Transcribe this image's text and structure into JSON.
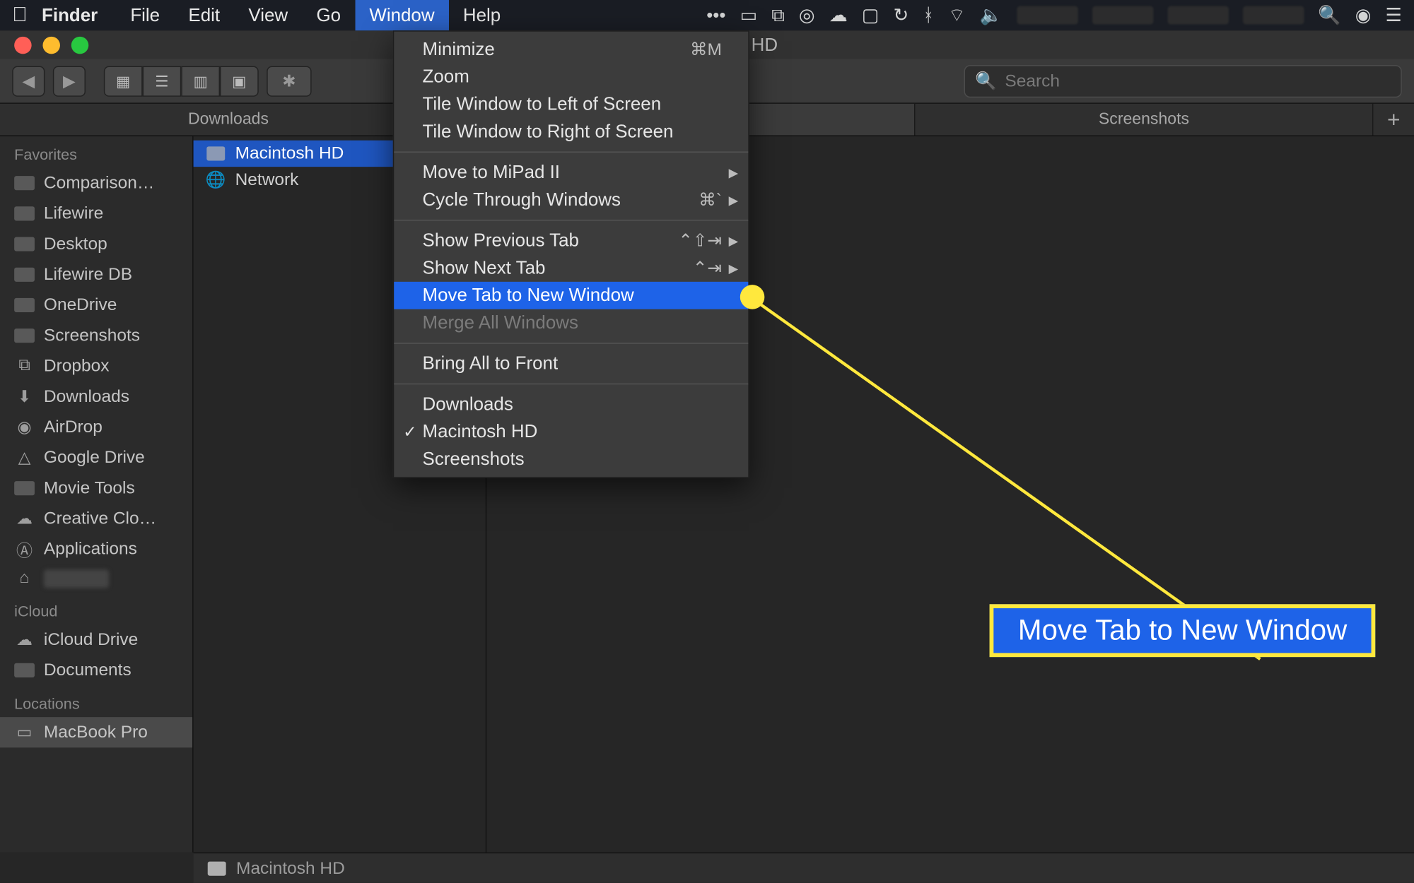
{
  "menubar": {
    "app": "Finder",
    "items": [
      "File",
      "Edit",
      "View",
      "Go",
      "Window",
      "Help"
    ],
    "active": "Window"
  },
  "window_title": "Macintosh HD",
  "search_placeholder": "Search",
  "tabs": [
    "Downloads",
    "Macintosh HD",
    "Screenshots"
  ],
  "active_tab": 1,
  "sidebar": {
    "sections": [
      {
        "title": "Favorites",
        "items": [
          {
            "label": "Comparison…",
            "icon": "folder"
          },
          {
            "label": "Lifewire",
            "icon": "folder"
          },
          {
            "label": "Desktop",
            "icon": "folder"
          },
          {
            "label": "Lifewire DB",
            "icon": "folder"
          },
          {
            "label": "OneDrive",
            "icon": "folder"
          },
          {
            "label": "Screenshots",
            "icon": "folder"
          },
          {
            "label": "Dropbox",
            "icon": "dropbox"
          },
          {
            "label": "Downloads",
            "icon": "download"
          },
          {
            "label": "AirDrop",
            "icon": "airdrop"
          },
          {
            "label": "Google Drive",
            "icon": "gdrive"
          },
          {
            "label": "Movie Tools",
            "icon": "folder"
          },
          {
            "label": "Creative Clo…",
            "icon": "cloud"
          },
          {
            "label": "Applications",
            "icon": "apps"
          },
          {
            "label": "",
            "icon": "home",
            "blurred": true
          }
        ]
      },
      {
        "title": "iCloud",
        "items": [
          {
            "label": "iCloud Drive",
            "icon": "cloud"
          },
          {
            "label": "Documents",
            "icon": "folder"
          }
        ]
      },
      {
        "title": "Locations",
        "items": [
          {
            "label": "MacBook Pro",
            "icon": "laptop",
            "selected": true
          }
        ]
      }
    ]
  },
  "column1": [
    {
      "label": "Macintosh HD",
      "icon": "disk",
      "selected": true
    },
    {
      "label": "Network",
      "icon": "globe"
    }
  ],
  "dropdown": [
    {
      "label": "Minimize",
      "shortcut": "⌘M"
    },
    {
      "label": "Zoom"
    },
    {
      "label": "Tile Window to Left of Screen"
    },
    {
      "label": "Tile Window to Right of Screen"
    },
    {
      "sep": true
    },
    {
      "label": "Move to MiPad II",
      "submenu": true
    },
    {
      "label": "Cycle Through Windows",
      "shortcut": "⌘`",
      "submenu": true
    },
    {
      "sep": true
    },
    {
      "label": "Show Previous Tab",
      "shortcut": "⌃⇧⇥",
      "submenu": true
    },
    {
      "label": "Show Next Tab",
      "shortcut": "⌃⇥",
      "submenu": true
    },
    {
      "label": "Move Tab to New Window",
      "hl": true
    },
    {
      "label": "Merge All Windows",
      "disabled": true
    },
    {
      "sep": true
    },
    {
      "label": "Bring All to Front"
    },
    {
      "sep": true
    },
    {
      "label": "Downloads"
    },
    {
      "label": "Macintosh HD",
      "checked": true
    },
    {
      "label": "Screenshots"
    }
  ],
  "callout_text": "Move Tab to New Window",
  "status_path": "Macintosh HD"
}
